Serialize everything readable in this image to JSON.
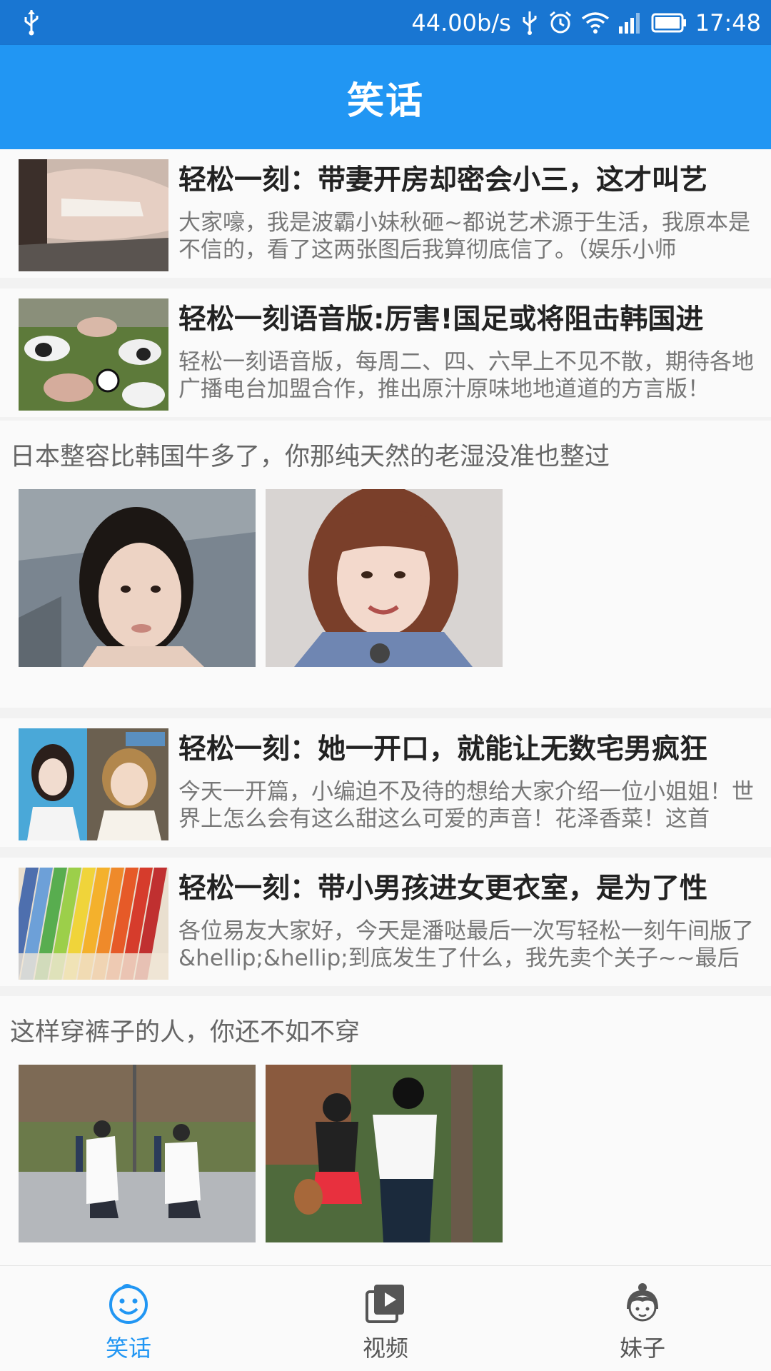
{
  "status_bar": {
    "speed": "44.00b/s",
    "time": "17:48",
    "icons": [
      "usb-icon",
      "usb-debug-icon",
      "alarm-icon",
      "wifi-icon",
      "signal-icon",
      "battery-icon"
    ]
  },
  "app_bar": {
    "title": "笑话"
  },
  "feed": {
    "articles": [
      {
        "title": "轻松一刻：带妻开房却密会小三，这才叫艺",
        "desc": "大家嚎，我是波霸小妹秋砸~都说艺术源于生活，我原本是不信的，看了这两张图后我算彻底信了。（娱乐小师"
      },
      {
        "title": "轻松一刻语音版:厉害!国足或将阻击韩国进",
        "desc": "轻松一刻语音版，每周二、四、六早上不见不散，期待各地广播电台加盟合作，推出原汁原味地地道道的方言版！"
      },
      {
        "title": "轻松一刻：她一开口，就能让无数宅男疯狂",
        "desc": "今天一开篇，小编迫不及待的想给大家介绍一位小姐姐！世界上怎么会有这么甜这么可爱的声音！花泽香菜！这首"
      },
      {
        "title": "轻松一刻：带小男孩进女更衣室，是为了性",
        "desc": "各位易友大家好，今天是潘哒最后一次写轻松一刻午间版了&hellip;&hellip;到底发生了什么，我先卖个关子~~最后"
      }
    ],
    "jokes": [
      {
        "text": "日本整容比韩国牛多了，你那纯天然的老湿没准也整过"
      },
      {
        "text": "这样穿裤子的人，你还不如不穿"
      }
    ]
  },
  "bottom_nav": {
    "items": [
      {
        "label": "笑话",
        "icon": "smiley-face-icon",
        "active": true
      },
      {
        "label": "视频",
        "icon": "video-play-icon",
        "active": false
      },
      {
        "label": "妹子",
        "icon": "girl-face-icon",
        "active": false
      }
    ]
  },
  "colors": {
    "status_bar": "#1976d2",
    "app_bar": "#2196f3",
    "active_tab": "#2196f3",
    "inactive_tab": "#555555"
  }
}
